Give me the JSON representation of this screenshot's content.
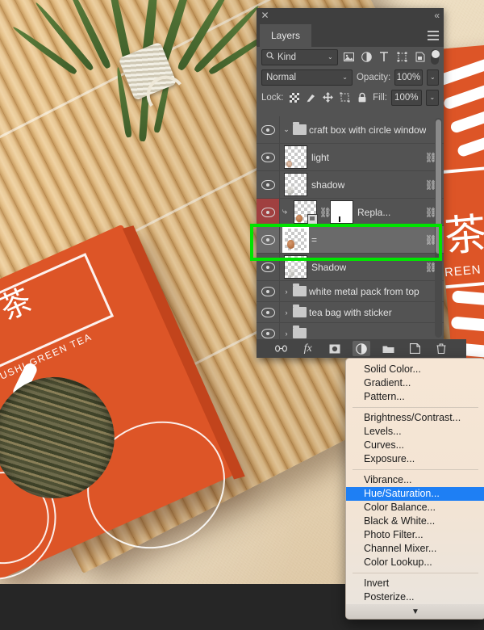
{
  "panel": {
    "close_icon": "✕",
    "collapse_icon": "«",
    "menu_icon": "panel-menu-icon",
    "tab_label": "Layers",
    "filter": {
      "search_icon": "🔍",
      "kind_label": "Kind",
      "caret": "⌄",
      "icons": [
        "pixel-filter-icon",
        "adjustment-filter-icon",
        "type-filter-icon",
        "shape-filter-icon",
        "smart-object-filter-icon"
      ],
      "toggle": "filter-toggle"
    },
    "blend": {
      "mode_label": "Normal",
      "caret": "⌄",
      "opacity_label": "Opacity:",
      "opacity_value": "100%"
    },
    "lock": {
      "label": "Lock:",
      "icons": [
        "transparency-lock-icon",
        "image-lock-icon",
        "position-lock-icon",
        "artboard-lock-icon",
        "all-lock-icon"
      ],
      "fill_label": "Fill:",
      "fill_value": "100%"
    },
    "layers": [
      {
        "name": "craft box with circle window",
        "type": "group",
        "expanded": true,
        "arrow": "⌄",
        "visible": true,
        "selected": false,
        "linked": false
      },
      {
        "name": "light",
        "type": "layer",
        "visible": true,
        "selected": false,
        "linked": true
      },
      {
        "name": "shadow",
        "type": "layer",
        "visible": true,
        "selected": false,
        "linked": true
      },
      {
        "name": "Repla...",
        "type": "smart-mask",
        "visible": true,
        "selected": false,
        "linked": true,
        "red": true,
        "clipped": true
      },
      {
        "name": "=",
        "type": "layer",
        "visible": true,
        "selected": true,
        "linked": true,
        "highlighted": true
      },
      {
        "name": "Shadow",
        "type": "layer",
        "visible": true,
        "selected": false,
        "linked": true
      },
      {
        "name": "white metal pack from top",
        "type": "group",
        "expanded": false,
        "arrow": "›",
        "visible": true,
        "selected": false,
        "linked": false
      },
      {
        "name": "tea bag with sticker",
        "type": "group",
        "expanded": false,
        "arrow": "›",
        "visible": true,
        "selected": false,
        "linked": false
      },
      {
        "name": "",
        "type": "group",
        "expanded": false,
        "arrow": "›",
        "visible": true,
        "selected": false,
        "linked": false
      }
    ],
    "bottom_buttons": [
      {
        "name": "link-layers-button",
        "glyph": "⛓"
      },
      {
        "name": "layer-style-button",
        "glyph": "fx"
      },
      {
        "name": "add-layer-mask-button",
        "glyph": "◙"
      },
      {
        "name": "new-adjustment-layer-button",
        "glyph": "◑",
        "active": true
      },
      {
        "name": "new-group-button",
        "glyph": "🗀"
      },
      {
        "name": "new-layer-button",
        "glyph": "❐"
      },
      {
        "name": "delete-layer-button",
        "glyph": "🗑"
      }
    ]
  },
  "context_menu": {
    "groups": [
      [
        "Solid Color...",
        "Gradient...",
        "Pattern..."
      ],
      [
        "Brightness/Contrast...",
        "Levels...",
        "Curves...",
        "Exposure..."
      ],
      [
        "Vibrance...",
        "Hue/Saturation...",
        "Color Balance...",
        "Black & White...",
        "Photo Filter...",
        "Channel Mixer...",
        "Color Lookup..."
      ],
      [
        "Invert",
        "Posterize..."
      ]
    ],
    "highlighted": "Hue/Saturation...",
    "scroll_glyph": "▼"
  },
  "photo": {
    "tea_box": {
      "japanese": "ほうじ茶",
      "subtitle": "...CHA FUKAMUSHI GREEN TEA"
    },
    "right_pack": {
      "kanji": "茶",
      "text": "REEN T"
    }
  },
  "colors": {
    "panel_bg": "#535353",
    "panel_header": "#3f3f3f",
    "selected_layer": "#6a6a6a",
    "red_marker": "#a04040",
    "highlight_box": "#00e400",
    "menu_highlight": "#1e7ff4",
    "menu_bg": "#f3e4d4",
    "package_orange": "#dd5527"
  }
}
